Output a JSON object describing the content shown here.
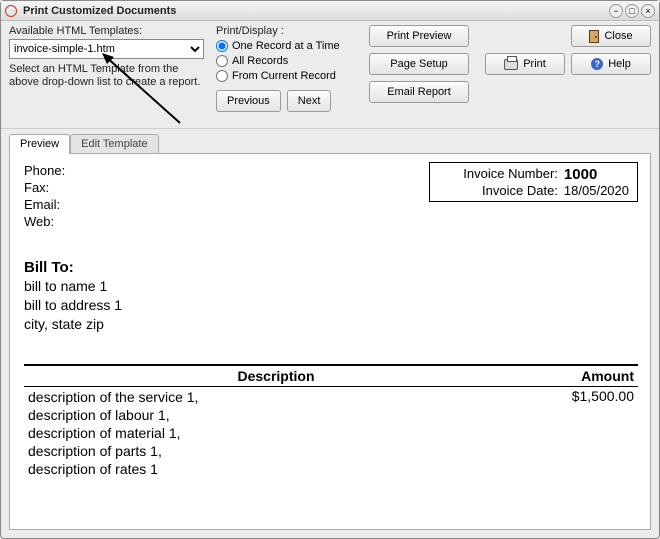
{
  "window": {
    "title": "Print Customized Documents",
    "minimize": "–",
    "maximize": "□",
    "close": "✕"
  },
  "templates": {
    "label": "Available HTML Templates:",
    "selected": "invoice-simple-1.htm",
    "hint": "Select an HTML Template from the above drop-down list to create a report."
  },
  "printDisplay": {
    "group": "Print/Display :",
    "opt1": "One Record at a Time",
    "opt2": "All Records",
    "opt3": "From Current Record"
  },
  "nav": {
    "prev": "Previous",
    "next": "Next"
  },
  "actions": {
    "preview": "Print Preview",
    "pageSetup": "Page Setup",
    "email": "Email Report",
    "close": "Close",
    "print": "Print",
    "help": "Help"
  },
  "tabs": {
    "preview": "Preview",
    "edit": "Edit Template"
  },
  "doc": {
    "contacts": {
      "phone": "Phone:",
      "fax": "Fax:",
      "email": "Email:",
      "web": "Web:"
    },
    "invoice": {
      "numLabel": "Invoice Number:",
      "numVal": "1000",
      "dateLabel": "Invoice Date:",
      "dateVal": "18/05/2020"
    },
    "billto": {
      "heading": "Bill To:",
      "name": "bill to name 1",
      "address": "bill to address 1",
      "csz": "city, state zip"
    },
    "table": {
      "col1": "Description",
      "col2": "Amount",
      "rows": [
        {
          "desc": "description of the service 1,\ndescription of labour 1,\ndescription of material 1,\ndescription of parts 1,\ndescription of rates 1",
          "amount": "$1,500.00"
        }
      ]
    }
  }
}
